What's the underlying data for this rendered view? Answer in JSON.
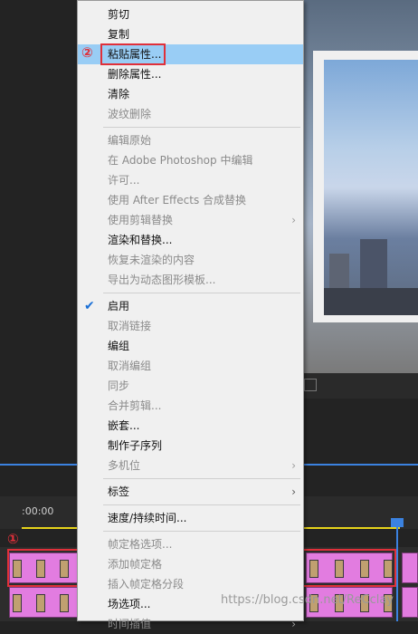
{
  "ruler": {
    "timecode": ":00:00"
  },
  "annotations": {
    "marker1": "①",
    "marker2": "②"
  },
  "menu": {
    "items": [
      {
        "label": "剪切",
        "state": "on"
      },
      {
        "label": "复制",
        "state": "on"
      },
      {
        "label": "粘贴属性...",
        "state": "highlight"
      },
      {
        "label": "删除属性...",
        "state": "on"
      },
      {
        "label": "清除",
        "state": "on"
      },
      {
        "label": "波纹删除",
        "state": "off"
      },
      {
        "label": "编辑原始",
        "state": "off"
      },
      {
        "label": "在 Adobe Photoshop 中编辑",
        "state": "off"
      },
      {
        "label": "许可...",
        "state": "off"
      },
      {
        "label": "使用 After Effects 合成替换",
        "state": "off"
      },
      {
        "label": "使用剪辑替换",
        "state": "off",
        "submenu": true
      },
      {
        "label": "渲染和替换...",
        "state": "on"
      },
      {
        "label": "恢复未渲染的内容",
        "state": "off"
      },
      {
        "label": "导出为动态图形模板...",
        "state": "off"
      },
      {
        "label": "启用",
        "state": "on",
        "checked": true
      },
      {
        "label": "取消链接",
        "state": "off"
      },
      {
        "label": "编组",
        "state": "on"
      },
      {
        "label": "取消编组",
        "state": "off"
      },
      {
        "label": "同步",
        "state": "off"
      },
      {
        "label": "合并剪辑...",
        "state": "off"
      },
      {
        "label": "嵌套...",
        "state": "on"
      },
      {
        "label": "制作子序列",
        "state": "on"
      },
      {
        "label": "多机位",
        "state": "off",
        "submenu": true
      },
      {
        "label": "标签",
        "state": "on",
        "submenu": true
      },
      {
        "label": "速度/持续时间...",
        "state": "on"
      },
      {
        "label": "帧定格选项...",
        "state": "off"
      },
      {
        "label": "添加帧定格",
        "state": "off"
      },
      {
        "label": "插入帧定格分段",
        "state": "off"
      },
      {
        "label": "场选项...",
        "state": "on"
      },
      {
        "label": "时间插值",
        "state": "off"
      }
    ]
  },
  "watermark": "https://blog.csdn.net/ReCclay",
  "colors": {
    "highlight": "#99cdf5",
    "annotation": "#e0303a",
    "clip": "#e27ce0",
    "playhead": "#3b82e0"
  }
}
